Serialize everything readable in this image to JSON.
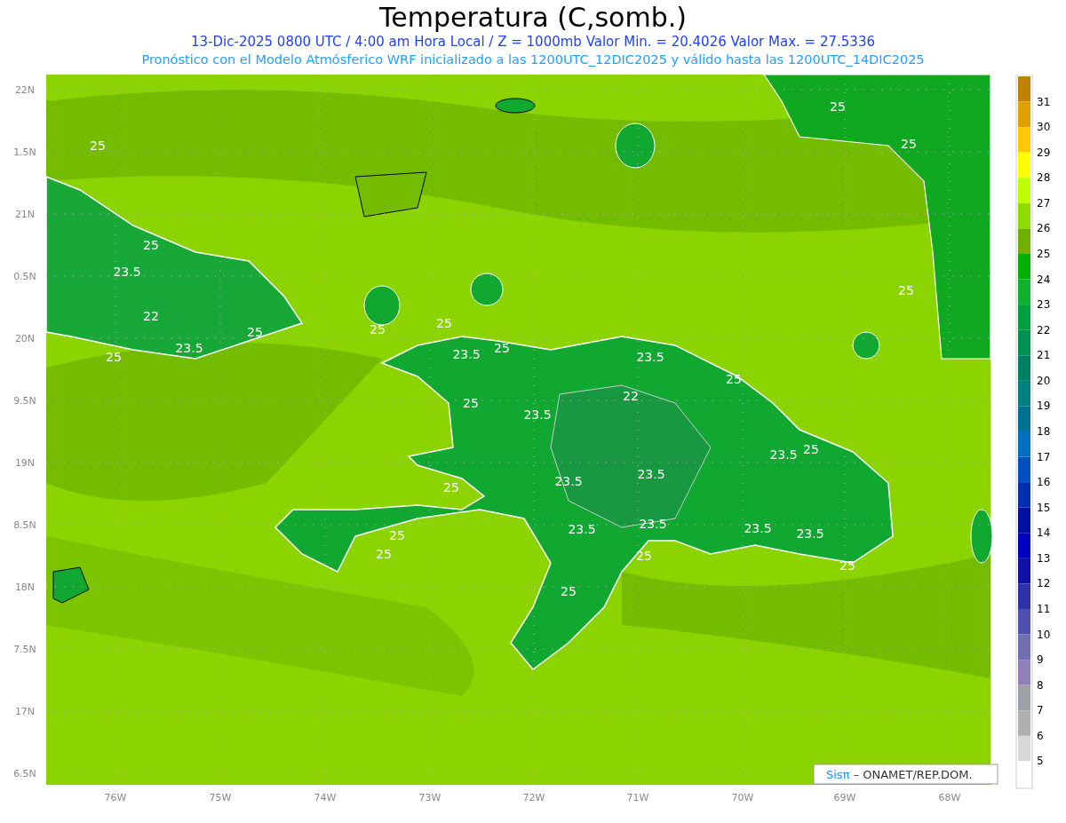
{
  "title": "Temperatura (C,somb.)",
  "subtitle": "13-Dic-2025  0800 UTC / 4:00 am Hora Local / Z = 1000mb   Valor Min. = 20.4026  Valor Max. = 27.5336",
  "description": "Pronóstico con el Modelo Atmósferico WRF inicializado a las 1200UTC_12DIC2025 y válido hasta las  1200UTC_14DIC2025",
  "map": {
    "y_labels": [
      "22N",
      "1.5N",
      "21N",
      "0.5N",
      "20N",
      "9.5N",
      "19N",
      "8.5N",
      "18N",
      "7.5N",
      "17N",
      "6.5N"
    ],
    "x_labels": [
      "76W",
      "75W",
      "74W",
      "73W",
      "72W",
      "71W",
      "70W",
      "69W",
      "68W"
    ],
    "contour_labels": [
      "25",
      "25",
      "25",
      "25",
      "23.5",
      "25",
      "22",
      "25",
      "25",
      "25",
      "25",
      "23.5",
      "23.5",
      "25",
      "23.5",
      "25",
      "22",
      "25",
      "23.5",
      "23.5",
      "25",
      "23.5",
      "23.5",
      "25",
      "25",
      "23.5",
      "23.5",
      "23.5",
      "23.5",
      "25",
      "25",
      "25",
      "25"
    ],
    "credit": {
      "brand": "Sisπ",
      "text": "– ONAMET/REP.DOM."
    }
  },
  "colorbar": [
    {
      "color": "#c08000",
      "label": "31"
    },
    {
      "color": "#e0a000",
      "label": "30"
    },
    {
      "color": "#ffc800",
      "label": "29"
    },
    {
      "color": "#ffff00",
      "label": "28"
    },
    {
      "color": "#c0ff00",
      "label": "27"
    },
    {
      "color": "#90dc00",
      "label": "26"
    },
    {
      "color": "#70b000",
      "label": "25"
    },
    {
      "color": "#00b000",
      "label": "24"
    },
    {
      "color": "#10b030",
      "label": "23"
    },
    {
      "color": "#00a040",
      "label": "22"
    },
    {
      "color": "#009050",
      "label": "21"
    },
    {
      "color": "#008060",
      "label": "20"
    },
    {
      "color": "#008080",
      "label": "19"
    },
    {
      "color": "#007090",
      "label": "18"
    },
    {
      "color": "#0070c0",
      "label": "17"
    },
    {
      "color": "#0050c0",
      "label": "16"
    },
    {
      "color": "#0030b0",
      "label": "15"
    },
    {
      "color": "#0010a0",
      "label": "14"
    },
    {
      "color": "#0000c0",
      "label": "13"
    },
    {
      "color": "#1010a8",
      "label": "12"
    },
    {
      "color": "#3030a8",
      "label": "11"
    },
    {
      "color": "#5050b0",
      "label": "10"
    },
    {
      "color": "#7070b0",
      "label": "9"
    },
    {
      "color": "#9080b8",
      "label": "8"
    },
    {
      "color": "#a0a0a8",
      "label": "7"
    },
    {
      "color": "#b0b0b0",
      "label": "6"
    },
    {
      "color": "#d8d8d8",
      "label": "5"
    },
    {
      "color": "#ffffff"
    }
  ]
}
